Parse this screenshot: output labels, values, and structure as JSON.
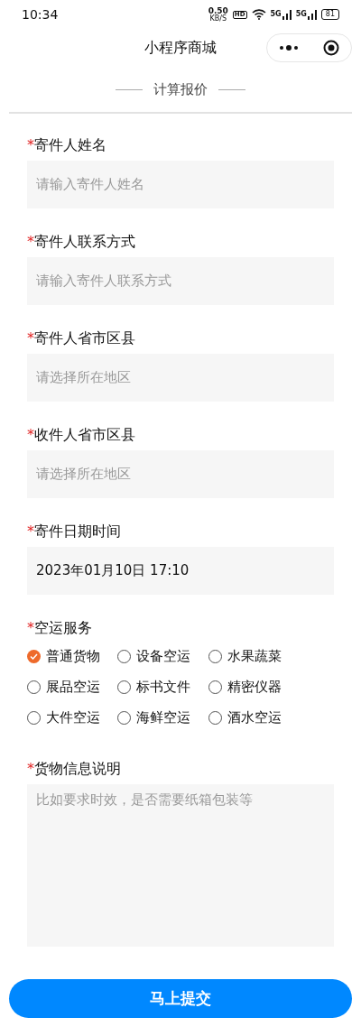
{
  "status_bar": {
    "time": "10:34",
    "speed": "0.50",
    "speed_unit": "KB/S",
    "hd": "HD",
    "network_1": "5G",
    "network_2": "5G",
    "battery": "81"
  },
  "nav_bar": {
    "title": "小程序商城"
  },
  "section_title": "计算报价",
  "fields": [
    {
      "kind": "input",
      "mark": "*",
      "label": "寄件人姓名",
      "placeholder": "请输入寄件人姓名"
    },
    {
      "kind": "input",
      "mark": "*",
      "label": "寄件人联系方式",
      "placeholder": "请输入寄件人联系方式"
    },
    {
      "kind": "picker",
      "mark": "*",
      "label": "寄件人省市区县",
      "placeholder": "请选择所在地区"
    },
    {
      "kind": "picker",
      "mark": "*",
      "label": "收件人省市区县",
      "placeholder": "请选择所在地区"
    },
    {
      "kind": "picker",
      "mark": "*",
      "label": "寄件日期时间",
      "value": "2023年01月10日 17:10"
    }
  ],
  "service": {
    "mark": "*",
    "label": "空运服务",
    "options": [
      {
        "label": "普通货物",
        "selected": true
      },
      {
        "label": "设备空运",
        "selected": false
      },
      {
        "label": "水果蔬菜",
        "selected": false
      },
      {
        "label": "展品空运",
        "selected": false
      },
      {
        "label": "标书文件",
        "selected": false
      },
      {
        "label": "精密仪器",
        "selected": false
      },
      {
        "label": "大件空运",
        "selected": false
      },
      {
        "label": "海鲜空运",
        "selected": false
      },
      {
        "label": "酒水空运",
        "selected": false
      }
    ]
  },
  "cargo": {
    "mark": "*",
    "label": "货物信息说明",
    "placeholder": "比如要求时效，是否需要纸箱包装等"
  },
  "submit_button": "马上提交"
}
